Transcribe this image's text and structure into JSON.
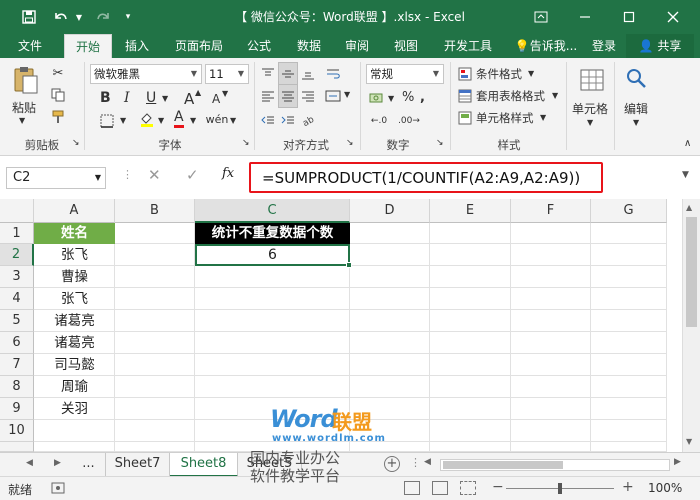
{
  "title": "【 微信公众号：Word联盟 】.xlsx - Excel",
  "quick_access": {
    "save_icon": "save-icon",
    "undo_icon": "undo-icon",
    "redo_icon": "redo-icon",
    "customize_icon": "customize-icon"
  },
  "window": {
    "ribbon_display": "ribbon-display-icon",
    "minimize": "minimize-icon",
    "restore": "restore-icon",
    "close": "close-icon"
  },
  "tabs": [
    "文件",
    "开始",
    "插入",
    "页面布局",
    "公式",
    "数据",
    "审阅",
    "视图",
    "开发工具"
  ],
  "active_tab": "开始",
  "tell_me": "告诉我...",
  "login": "登录",
  "share": "共享",
  "ribbon": {
    "clipboard": {
      "paste": "粘贴",
      "label": "剪贴板"
    },
    "font": {
      "name": "微软雅黑",
      "size": "11",
      "bold": "B",
      "italic": "I",
      "underline": "U",
      "grow": "A",
      "shrink": "A",
      "font_color_letter": "A",
      "label": "字体"
    },
    "alignment": {
      "label": "对齐方式"
    },
    "number": {
      "format": "常规",
      "percent": "%",
      "label": "数字"
    },
    "styles": {
      "conditional": "条件格式",
      "table": "套用表格格式",
      "cell_styles": "单元格样式",
      "label": "样式"
    },
    "cells": {
      "label": "单元格"
    },
    "editing": {
      "label": "编辑"
    }
  },
  "formula_bar": {
    "name_box": "C2",
    "fx": "fx",
    "formula": "=SUMPRODUCT(1/COUNTIF(A2:A9,A2:A9))"
  },
  "columns": [
    "A",
    "B",
    "C",
    "D",
    "E",
    "F",
    "G"
  ],
  "rows": [
    "1",
    "2",
    "3",
    "4",
    "5",
    "6",
    "7",
    "8",
    "9",
    "10"
  ],
  "cells": {
    "A1": "姓名",
    "C1": "统计不重复数据个数",
    "C2": "6",
    "A_values": [
      "张飞",
      "曹操",
      "张飞",
      "诸葛亮",
      "诸葛亮",
      "司马懿",
      "周瑜",
      "关羽"
    ]
  },
  "colors": {
    "header_green": "#70ad47",
    "header_black": "#000000",
    "excel_green": "#217346",
    "highlight_red": "#e8141a"
  },
  "sheet_tabs": {
    "ellipsis": "...",
    "tabs": [
      "Sheet7",
      "Sheet8",
      "Sheet5"
    ]
  },
  "active_sheet": "Sheet8",
  "status": {
    "ready": "就绪",
    "zoom": "100%"
  },
  "watermark": {
    "brand_word": "Word",
    "brand_cn": "联盟",
    "url": "www.wordlm.com",
    "line1": "国内专业办公",
    "line2": "软件教学平台"
  }
}
